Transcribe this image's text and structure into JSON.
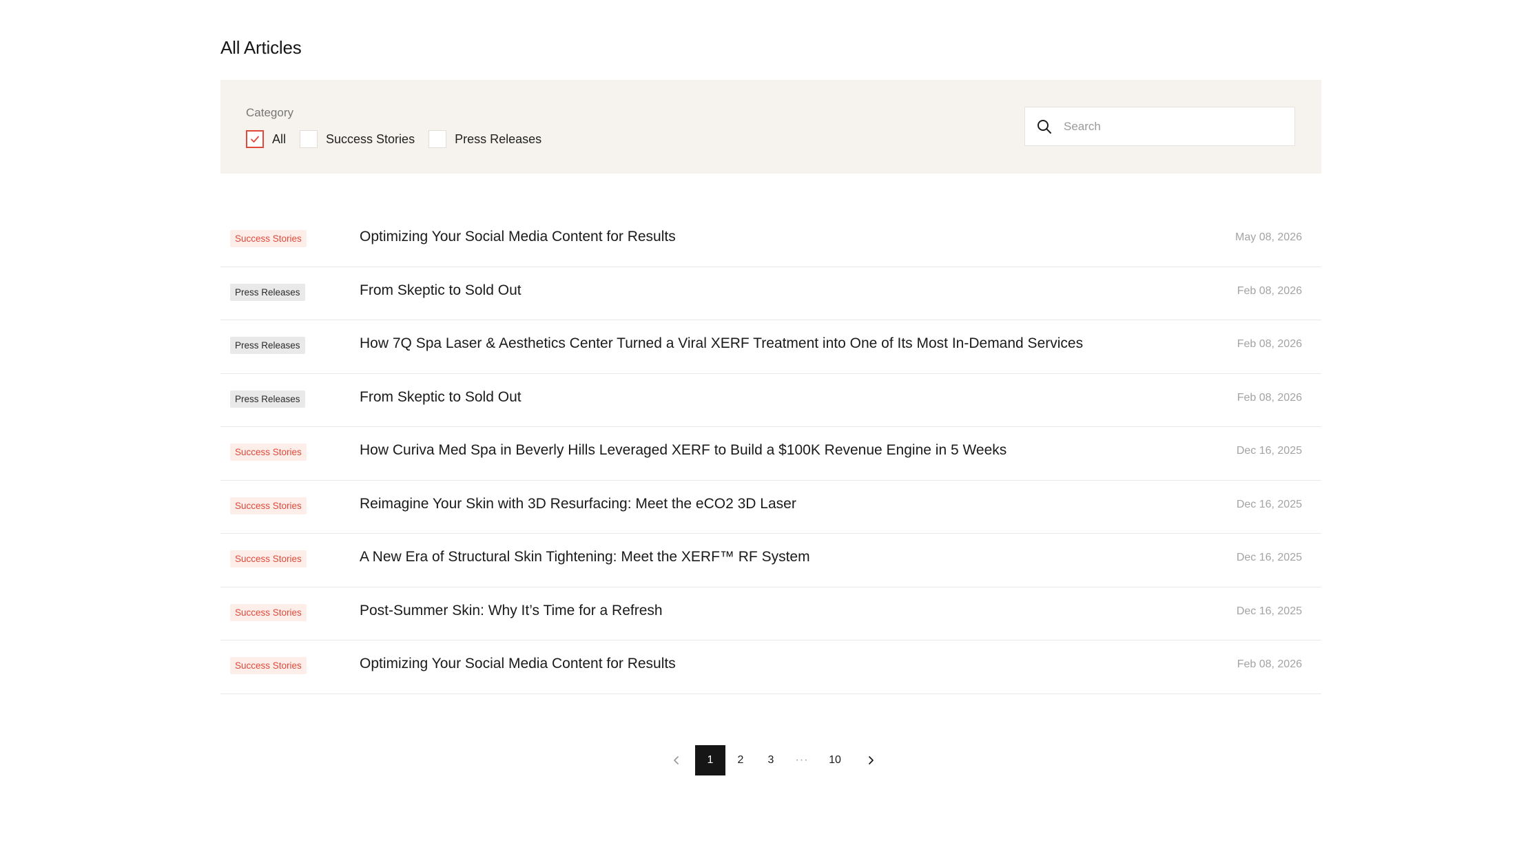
{
  "page": {
    "title": "All Articles"
  },
  "filters": {
    "label": "Category",
    "options": [
      {
        "label": "All",
        "checked": true
      },
      {
        "label": "Success Stories",
        "checked": false
      },
      {
        "label": "Press Releases",
        "checked": false
      }
    ],
    "search": {
      "placeholder": "Search",
      "value": ""
    }
  },
  "articles": [
    {
      "tag": "Success Stories",
      "title": "Optimizing Your Social Media Content for Results",
      "date": "May 08, 2026"
    },
    {
      "tag": "Press Releases",
      "title": "From Skeptic to Sold Out",
      "date": "Feb 08, 2026"
    },
    {
      "tag": "Press Releases",
      "title": "How 7Q Spa Laser & Aesthetics Center Turned a Viral XERF Treatment into One of Its Most In-Demand Services",
      "date": "Feb 08, 2026"
    },
    {
      "tag": "Press Releases",
      "title": "From Skeptic to Sold Out",
      "date": "Feb 08, 2026"
    },
    {
      "tag": "Success Stories",
      "title": "How Curiva Med Spa in Beverly Hills Leveraged XERF to Build a $100K Revenue Engine in 5 Weeks",
      "date": "Dec 16, 2025"
    },
    {
      "tag": "Success Stories",
      "title": "Reimagine Your Skin with 3D Resurfacing: Meet the eCO2 3D Laser",
      "date": "Dec 16, 2025"
    },
    {
      "tag": "Success Stories",
      "title": "A New Era of Structural Skin Tightening: Meet the XERF™ RF System",
      "date": "Dec 16, 2025"
    },
    {
      "tag": "Success Stories",
      "title": "Post-Summer Skin: Why It’s Time for a Refresh",
      "date": "Dec 16, 2025"
    },
    {
      "tag": "Success Stories",
      "title": "Optimizing Your Social Media Content for Results",
      "date": "Feb 08, 2026"
    }
  ],
  "pagination": {
    "pages": [
      "1",
      "2",
      "3"
    ],
    "ellipsis": "···",
    "last": "10",
    "current": "1"
  },
  "colors": {
    "accent": "#e0493a",
    "filter_bg": "#f6f2ed",
    "success_tag_bg": "#fdeeea",
    "press_tag_bg": "#e9e9e9",
    "active_page_bg": "#161616"
  },
  "icons": {
    "search": "search-icon",
    "check": "check-icon",
    "prev": "chevron-left-icon",
    "next": "chevron-right-icon"
  }
}
